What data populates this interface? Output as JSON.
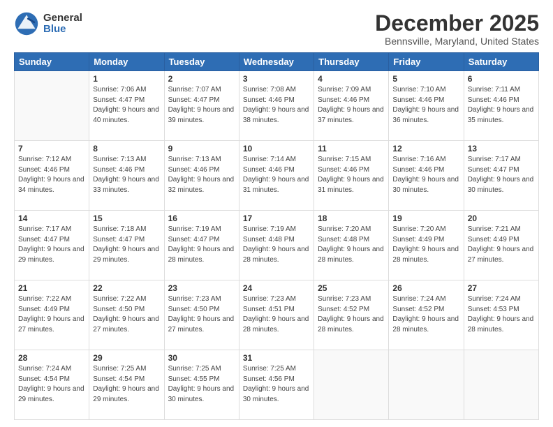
{
  "logo": {
    "general": "General",
    "blue": "Blue"
  },
  "title": "December 2025",
  "subtitle": "Bennsville, Maryland, United States",
  "days_header": [
    "Sunday",
    "Monday",
    "Tuesday",
    "Wednesday",
    "Thursday",
    "Friday",
    "Saturday"
  ],
  "weeks": [
    [
      {
        "num": "",
        "empty": true
      },
      {
        "num": "1",
        "sunrise": "7:06 AM",
        "sunset": "4:47 PM",
        "daylight": "9 hours and 40 minutes."
      },
      {
        "num": "2",
        "sunrise": "7:07 AM",
        "sunset": "4:47 PM",
        "daylight": "9 hours and 39 minutes."
      },
      {
        "num": "3",
        "sunrise": "7:08 AM",
        "sunset": "4:46 PM",
        "daylight": "9 hours and 38 minutes."
      },
      {
        "num": "4",
        "sunrise": "7:09 AM",
        "sunset": "4:46 PM",
        "daylight": "9 hours and 37 minutes."
      },
      {
        "num": "5",
        "sunrise": "7:10 AM",
        "sunset": "4:46 PM",
        "daylight": "9 hours and 36 minutes."
      },
      {
        "num": "6",
        "sunrise": "7:11 AM",
        "sunset": "4:46 PM",
        "daylight": "9 hours and 35 minutes."
      }
    ],
    [
      {
        "num": "7",
        "sunrise": "7:12 AM",
        "sunset": "4:46 PM",
        "daylight": "9 hours and 34 minutes."
      },
      {
        "num": "8",
        "sunrise": "7:13 AM",
        "sunset": "4:46 PM",
        "daylight": "9 hours and 33 minutes."
      },
      {
        "num": "9",
        "sunrise": "7:13 AM",
        "sunset": "4:46 PM",
        "daylight": "9 hours and 32 minutes."
      },
      {
        "num": "10",
        "sunrise": "7:14 AM",
        "sunset": "4:46 PM",
        "daylight": "9 hours and 31 minutes."
      },
      {
        "num": "11",
        "sunrise": "7:15 AM",
        "sunset": "4:46 PM",
        "daylight": "9 hours and 31 minutes."
      },
      {
        "num": "12",
        "sunrise": "7:16 AM",
        "sunset": "4:46 PM",
        "daylight": "9 hours and 30 minutes."
      },
      {
        "num": "13",
        "sunrise": "7:17 AM",
        "sunset": "4:47 PM",
        "daylight": "9 hours and 30 minutes."
      }
    ],
    [
      {
        "num": "14",
        "sunrise": "7:17 AM",
        "sunset": "4:47 PM",
        "daylight": "9 hours and 29 minutes."
      },
      {
        "num": "15",
        "sunrise": "7:18 AM",
        "sunset": "4:47 PM",
        "daylight": "9 hours and 29 minutes."
      },
      {
        "num": "16",
        "sunrise": "7:19 AM",
        "sunset": "4:47 PM",
        "daylight": "9 hours and 28 minutes."
      },
      {
        "num": "17",
        "sunrise": "7:19 AM",
        "sunset": "4:48 PM",
        "daylight": "9 hours and 28 minutes."
      },
      {
        "num": "18",
        "sunrise": "7:20 AM",
        "sunset": "4:48 PM",
        "daylight": "9 hours and 28 minutes."
      },
      {
        "num": "19",
        "sunrise": "7:20 AM",
        "sunset": "4:49 PM",
        "daylight": "9 hours and 28 minutes."
      },
      {
        "num": "20",
        "sunrise": "7:21 AM",
        "sunset": "4:49 PM",
        "daylight": "9 hours and 27 minutes."
      }
    ],
    [
      {
        "num": "21",
        "sunrise": "7:22 AM",
        "sunset": "4:49 PM",
        "daylight": "9 hours and 27 minutes."
      },
      {
        "num": "22",
        "sunrise": "7:22 AM",
        "sunset": "4:50 PM",
        "daylight": "9 hours and 27 minutes."
      },
      {
        "num": "23",
        "sunrise": "7:23 AM",
        "sunset": "4:50 PM",
        "daylight": "9 hours and 27 minutes."
      },
      {
        "num": "24",
        "sunrise": "7:23 AM",
        "sunset": "4:51 PM",
        "daylight": "9 hours and 28 minutes."
      },
      {
        "num": "25",
        "sunrise": "7:23 AM",
        "sunset": "4:52 PM",
        "daylight": "9 hours and 28 minutes."
      },
      {
        "num": "26",
        "sunrise": "7:24 AM",
        "sunset": "4:52 PM",
        "daylight": "9 hours and 28 minutes."
      },
      {
        "num": "27",
        "sunrise": "7:24 AM",
        "sunset": "4:53 PM",
        "daylight": "9 hours and 28 minutes."
      }
    ],
    [
      {
        "num": "28",
        "sunrise": "7:24 AM",
        "sunset": "4:54 PM",
        "daylight": "9 hours and 29 minutes."
      },
      {
        "num": "29",
        "sunrise": "7:25 AM",
        "sunset": "4:54 PM",
        "daylight": "9 hours and 29 minutes."
      },
      {
        "num": "30",
        "sunrise": "7:25 AM",
        "sunset": "4:55 PM",
        "daylight": "9 hours and 30 minutes."
      },
      {
        "num": "31",
        "sunrise": "7:25 AM",
        "sunset": "4:56 PM",
        "daylight": "9 hours and 30 minutes."
      },
      {
        "num": "",
        "empty": true
      },
      {
        "num": "",
        "empty": true
      },
      {
        "num": "",
        "empty": true
      }
    ]
  ]
}
